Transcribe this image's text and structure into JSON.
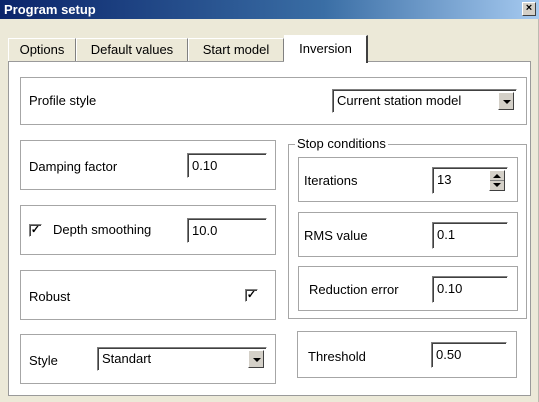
{
  "window": {
    "title": "Program setup",
    "close_glyph": "×"
  },
  "tabs": [
    {
      "label": "Options"
    },
    {
      "label": "Default values"
    },
    {
      "label": "Start model"
    },
    {
      "label": "Inversion"
    }
  ],
  "profile_style": {
    "label": "Profile style",
    "value": "Current station model"
  },
  "damping": {
    "label": "Damping factor",
    "value": "0.10"
  },
  "depth_smoothing": {
    "label": "Depth smoothing",
    "checked": true,
    "check_glyph": "✓",
    "value": "10.0"
  },
  "robust": {
    "label": "Robust",
    "checked": true,
    "check_glyph": "✓"
  },
  "style": {
    "label": "Style",
    "value": "Standart"
  },
  "stop_conditions": {
    "title": "Stop conditions",
    "iterations": {
      "label": "Iterations",
      "value": "13"
    },
    "rms": {
      "label": "RMS value",
      "value": "0.1"
    },
    "reduction": {
      "label": "Reduction error",
      "value": "0.10"
    }
  },
  "threshold": {
    "label": "Threshold",
    "value": "0.50"
  },
  "colors": {
    "titlebar": "#0a246a",
    "face": "#ece9d8",
    "panel": "#ffffff"
  }
}
